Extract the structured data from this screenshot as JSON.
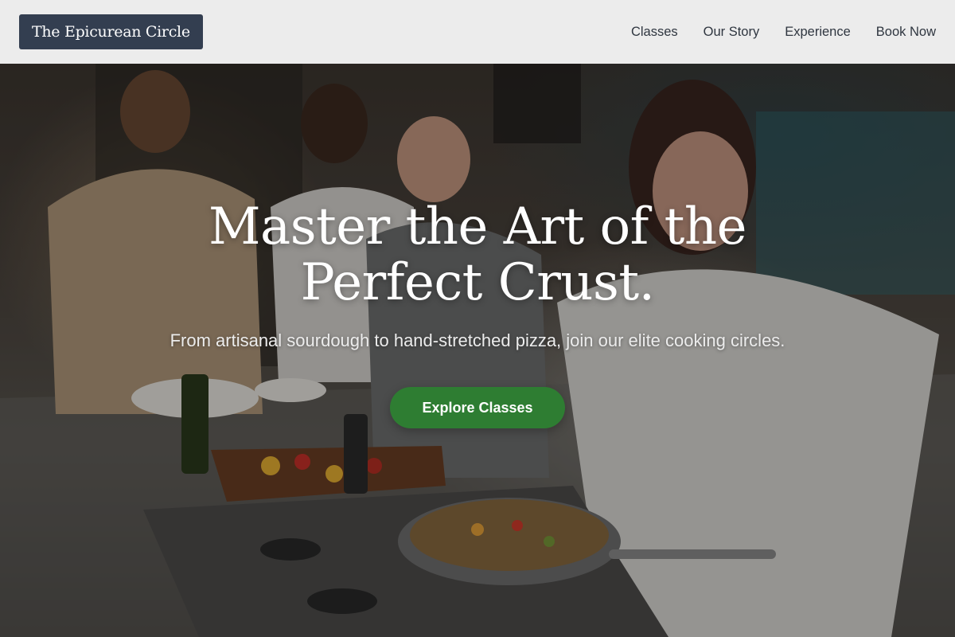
{
  "header": {
    "logo_text": "The Epicurean Circle",
    "nav": [
      {
        "label": "Classes"
      },
      {
        "label": "Our Story"
      },
      {
        "label": "Experience"
      },
      {
        "label": "Book Now"
      }
    ]
  },
  "hero": {
    "title_line1": "Master the Art of the",
    "title_line2": "Perfect Crust.",
    "subtitle": "From artisanal sourdough to hand-stretched pizza, join our elite cooking circles.",
    "cta_label": "Explore Classes",
    "background_image": "kitchen-cooking-class-photo"
  },
  "colors": {
    "header_bg": "#f3f3f3",
    "logo_bg": "#333e50",
    "cta_bg": "#2e7d32",
    "nav_text": "#2f3640"
  }
}
